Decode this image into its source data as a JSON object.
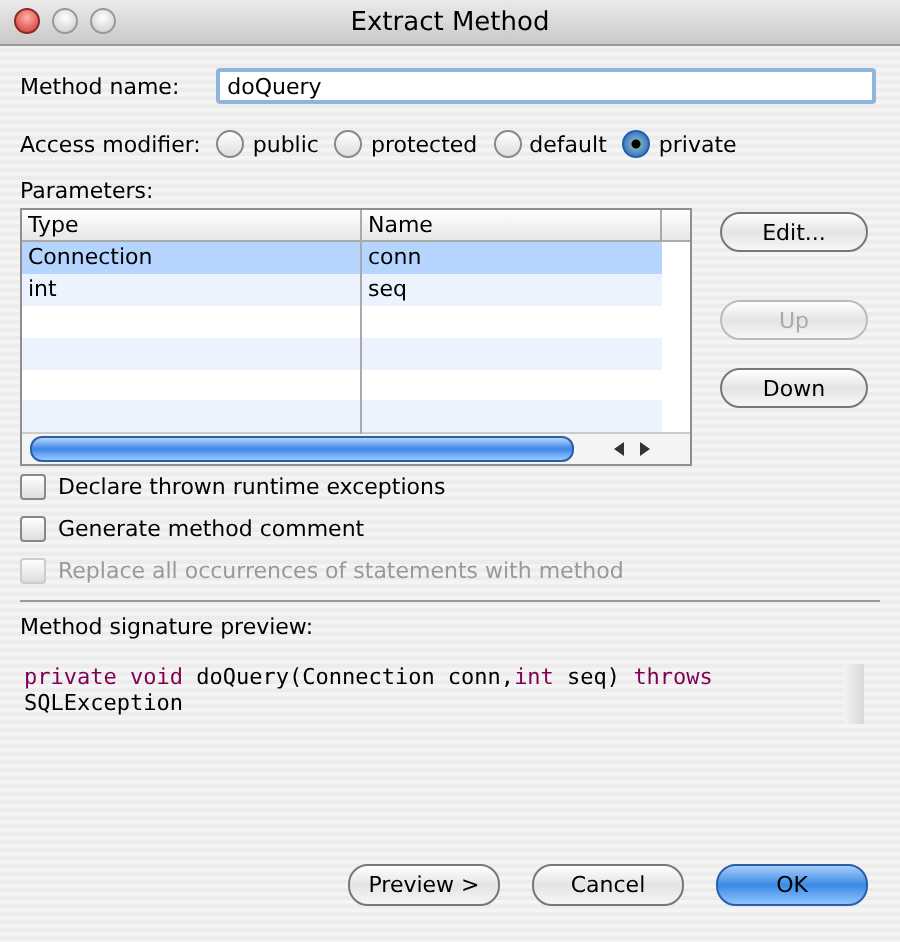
{
  "window": {
    "title": "Extract Method"
  },
  "method_name": {
    "label": "Method name:",
    "value": "doQuery"
  },
  "access_modifier": {
    "label": "Access modifier:",
    "options": [
      {
        "label": "public",
        "selected": false
      },
      {
        "label": "protected",
        "selected": false
      },
      {
        "label": "default",
        "selected": false
      },
      {
        "label": "private",
        "selected": true
      }
    ]
  },
  "parameters": {
    "label": "Parameters:",
    "columns": [
      "Type",
      "Name"
    ],
    "rows": [
      {
        "cells": [
          "Connection",
          "conn"
        ],
        "selected": true
      },
      {
        "cells": [
          "int",
          "seq"
        ],
        "selected": false
      }
    ],
    "buttons": [
      {
        "label": "Edit...",
        "disabled": false
      },
      {
        "label": "Up",
        "disabled": true
      },
      {
        "label": "Down",
        "disabled": false
      }
    ]
  },
  "options": [
    {
      "label": "Declare thrown runtime exceptions",
      "checked": false,
      "disabled": false
    },
    {
      "label": "Generate method comment",
      "checked": false,
      "disabled": false
    },
    {
      "label": "Replace all occurrences of statements with method",
      "checked": false,
      "disabled": true
    }
  ],
  "signature_preview": {
    "label": "Method signature preview:",
    "lines": [
      [
        {
          "text": "private ",
          "kind": "keyword"
        },
        {
          "text": "void",
          "kind": "keyword"
        },
        {
          "text": " doQuery(Connection conn,",
          "kind": "plain"
        },
        {
          "text": "int",
          "kind": "keyword"
        },
        {
          "text": " seq) ",
          "kind": "plain"
        },
        {
          "text": "throws",
          "kind": "keyword"
        }
      ],
      [
        {
          "text": "SQLException",
          "kind": "plain"
        }
      ]
    ]
  },
  "buttons": [
    {
      "label": "Preview >",
      "default": false
    },
    {
      "label": "Cancel",
      "default": false
    },
    {
      "label": "OK",
      "default": true
    }
  ]
}
